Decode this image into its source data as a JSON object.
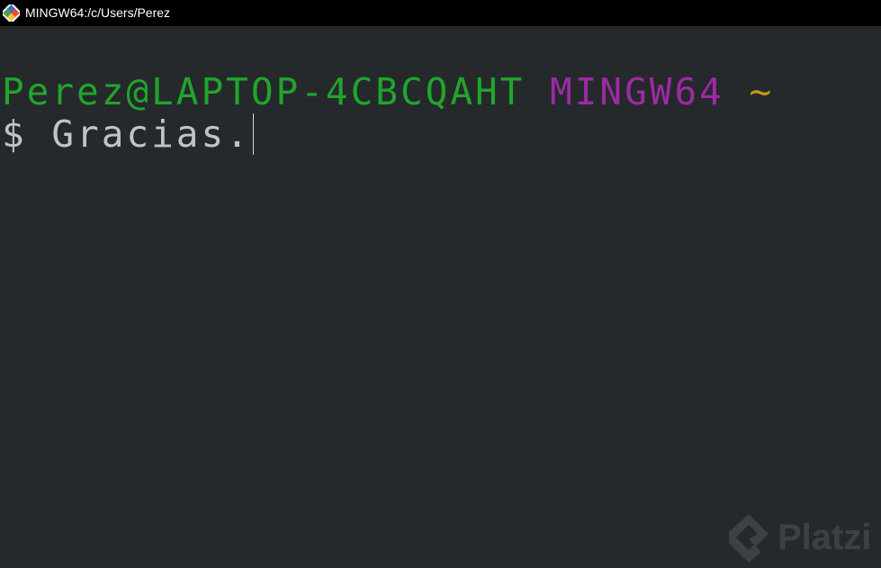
{
  "window": {
    "title": "MINGW64:/c/Users/Perez",
    "icon": "git-bash-icon"
  },
  "terminal": {
    "prompt": {
      "user_host": "Perez@LAPTOP-4CBCQAHT",
      "environment": "MINGW64",
      "path": "~"
    },
    "input_line": {
      "symbol": "$",
      "text": "Gracias."
    }
  },
  "watermark": {
    "text": "Platzi",
    "icon": "platzi-logo-icon"
  },
  "colors": {
    "background": "#25292c",
    "titlebar": "#000000",
    "user_host": "#21a52b",
    "environment": "#9d2aa5",
    "path": "#c39b16",
    "text": "#c3c3c3"
  }
}
